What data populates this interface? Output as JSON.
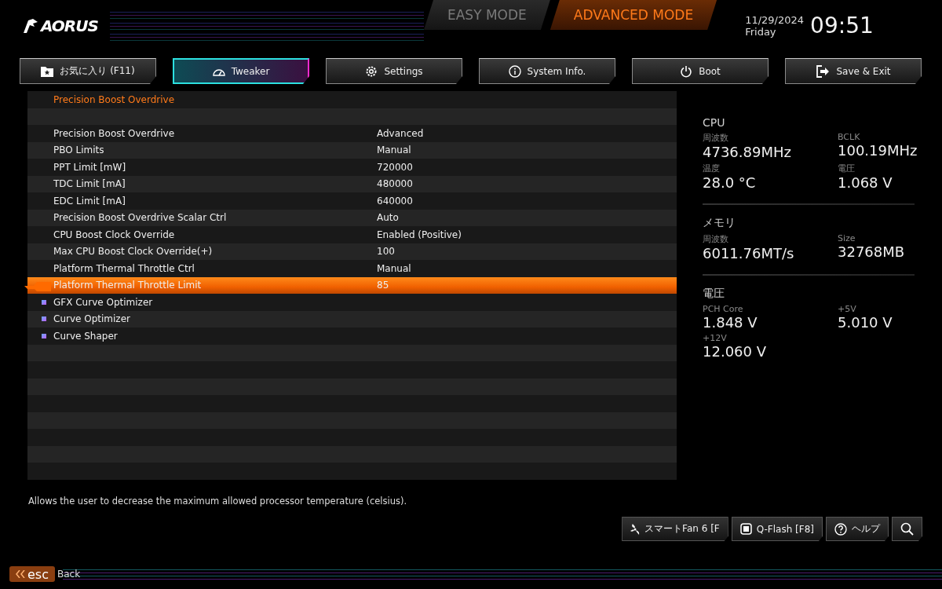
{
  "logo": "AORUS",
  "modes": [
    {
      "label": "EASY MODE",
      "selected": false
    },
    {
      "label": "ADVANCED MODE",
      "selected": true
    }
  ],
  "clock": {
    "date": "11/29/2024",
    "day": "Friday",
    "time": "09:51"
  },
  "tabs": [
    {
      "label": "お気に入り (F11)",
      "selected": false
    },
    {
      "label": "Tweaker",
      "selected": true
    },
    {
      "label": "Settings",
      "selected": false
    },
    {
      "label": "System Info.",
      "selected": false
    },
    {
      "label": "Boot",
      "selected": false
    },
    {
      "label": "Save & Exit",
      "selected": false
    }
  ],
  "settings": {
    "title": "Precision Boost Overdrive",
    "items": [
      {
        "kind": "setting",
        "label": "Precision Boost Overdrive",
        "value": "Advanced",
        "selected": false
      },
      {
        "kind": "setting",
        "label": "PBO Limits",
        "value": "Manual",
        "selected": false
      },
      {
        "kind": "setting",
        "label": "PPT Limit [mW]",
        "value": "720000",
        "selected": false
      },
      {
        "kind": "setting",
        "label": "TDC Limit [mA]",
        "value": "480000",
        "selected": false
      },
      {
        "kind": "setting",
        "label": "EDC Limit [mA]",
        "value": "640000",
        "selected": false
      },
      {
        "kind": "setting",
        "label": "Precision Boost Overdrive Scalar Ctrl",
        "value": "Auto",
        "selected": false
      },
      {
        "kind": "setting",
        "label": "CPU Boost Clock Override",
        "value": "Enabled (Positive)",
        "selected": false
      },
      {
        "kind": "setting",
        "label": "Max CPU Boost Clock Override(+)",
        "value": "100",
        "selected": false
      },
      {
        "kind": "setting",
        "label": "Platform Thermal Throttle Ctrl",
        "value": "Manual",
        "selected": false
      },
      {
        "kind": "setting",
        "label": "Platform Thermal Throttle Limit",
        "value": "85",
        "selected": true
      },
      {
        "kind": "submenu",
        "label": "GFX Curve Optimizer",
        "selected": false
      },
      {
        "kind": "submenu",
        "label": "Curve Optimizer",
        "selected": false
      },
      {
        "kind": "submenu",
        "label": "Curve Shaper",
        "selected": false
      }
    ]
  },
  "hardware": [
    {
      "title": "CPU",
      "readings": [
        {
          "label": "周波数",
          "value": "4736.89MHz"
        },
        {
          "label": "BCLK",
          "value": "100.19MHz"
        },
        {
          "label": "温度",
          "value": "28.0 °C"
        },
        {
          "label": "電圧",
          "value": "1.068 V"
        }
      ]
    },
    {
      "title": "メモリ",
      "readings": [
        {
          "label": "周波数",
          "value": "6011.76MT/s"
        },
        {
          "label": "Size",
          "value": "32768MB"
        }
      ]
    },
    {
      "title": "電圧",
      "readings": [
        {
          "label": "PCH Core",
          "value": "1.848 V"
        },
        {
          "label": "+5V",
          "value": "5.010 V"
        },
        {
          "label": "+12V",
          "value": "12.060 V"
        }
      ]
    }
  ],
  "description": "Allows the user to decrease the maximum allowed processor temperature (celsius).",
  "tools": [
    {
      "label": "スマートFan 6 [F"
    },
    {
      "label": "Q-Flash [F8]"
    },
    {
      "label": "ヘルプ"
    }
  ],
  "back": {
    "key": "esc",
    "label": "Back"
  }
}
